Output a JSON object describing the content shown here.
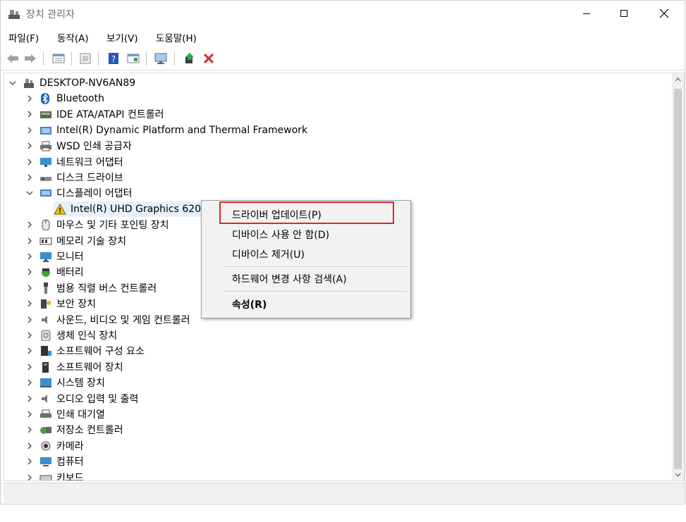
{
  "window": {
    "title": "장치 관리자"
  },
  "menu": [
    "파일(F)",
    "동작(A)",
    "보기(V)",
    "도움말(H)"
  ],
  "toolbar_icons": [
    "back-icon",
    "forward-icon",
    "properties-icon",
    "show-hidden-icon",
    "help-icon",
    "view-icon",
    "computer-icon",
    "update-driver-icon",
    "uninstall-icon"
  ],
  "tree": {
    "root": "DESKTOP-NV6AN89",
    "items": [
      {
        "label": "Bluetooth",
        "expanded": false
      },
      {
        "label": "IDE ATA/ATAPI 컨트롤러",
        "expanded": false
      },
      {
        "label": "Intel(R) Dynamic Platform and Thermal Framework",
        "expanded": false
      },
      {
        "label": "WSD 인쇄 공급자",
        "expanded": false
      },
      {
        "label": "네트워크 어댑터",
        "expanded": false
      },
      {
        "label": "디스크 드라이브",
        "expanded": false
      },
      {
        "label": "디스플레이 어댑터",
        "expanded": true
      },
      {
        "label": "Intel(R) UHD Graphics 620",
        "child": true
      },
      {
        "label": "마우스 및 기타 포인팅 장치",
        "expanded": false
      },
      {
        "label": "메모리 기술 장치",
        "expanded": false
      },
      {
        "label": "모니터",
        "expanded": false
      },
      {
        "label": "배터리",
        "expanded": false
      },
      {
        "label": "범용 직렬 버스 컨트롤러",
        "expanded": false
      },
      {
        "label": "보안 장치",
        "expanded": false
      },
      {
        "label": "사운드, 비디오 및 게임 컨트롤러",
        "expanded": false
      },
      {
        "label": "생체 인식 장치",
        "expanded": false
      },
      {
        "label": "소프트웨어 구성 요소",
        "expanded": false
      },
      {
        "label": "소프트웨어 장치",
        "expanded": false
      },
      {
        "label": "시스템 장치",
        "expanded": false
      },
      {
        "label": "오디오 입력 및 출력",
        "expanded": false
      },
      {
        "label": "인쇄 대기열",
        "expanded": false
      },
      {
        "label": "저장소 컨트롤러",
        "expanded": false
      },
      {
        "label": "카메라",
        "expanded": false
      },
      {
        "label": "컴퓨터",
        "expanded": false
      },
      {
        "label": "키보드",
        "expanded": false
      }
    ]
  },
  "context_menu": {
    "update_driver": "드라이버 업데이트(P)",
    "disable": "디바이스 사용 안 함(D)",
    "uninstall": "디바이스 제거(U)",
    "scan": "하드웨어 변경 사항 검색(A)",
    "properties": "속성(R)"
  },
  "colors": {
    "highlight_border": "#e0262e",
    "selection": "#e5f1fb"
  }
}
